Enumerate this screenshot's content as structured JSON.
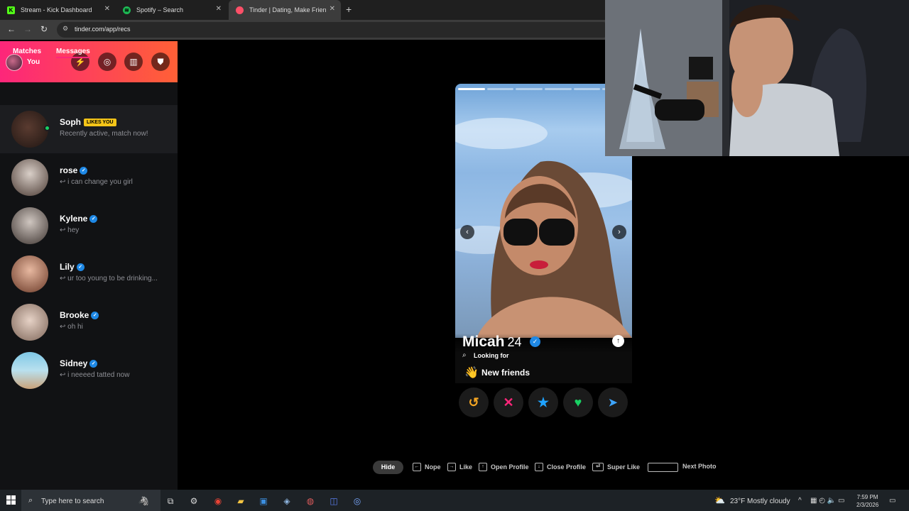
{
  "browser": {
    "tabs": [
      {
        "title": "Stream - Kick Dashboard",
        "icon": "kick-icon",
        "color": "#53fc18"
      },
      {
        "title": "Spotify – Search",
        "icon": "spotify-icon",
        "color": "#1db954"
      },
      {
        "title": "Tinder | Dating, Make Friends &",
        "icon": "tinder-icon",
        "color": "#fd5068"
      }
    ],
    "url": "tinder.com/app/recs"
  },
  "sidebar": {
    "you_label": "You",
    "tabs": {
      "matches": "Matches",
      "messages": "Messages"
    },
    "messages": [
      {
        "name": "Soph",
        "badge": "LIKES YOU",
        "preview": "Recently active, match now!"
      },
      {
        "name": "rose",
        "preview": "↩ i can change you girl"
      },
      {
        "name": "Kylene",
        "preview": "↩ hey"
      },
      {
        "name": "Lily",
        "preview": "↩ ur too young to be drinking..."
      },
      {
        "name": "Brooke",
        "preview": "↩ oh hi"
      },
      {
        "name": "Sidney",
        "preview": "↩ i neeeed tatted now"
      }
    ]
  },
  "card": {
    "name": "Micah",
    "age": "24",
    "looking_for_label": "Looking for",
    "looking_for_value": "New friends",
    "photo_count": 6,
    "current_photo": 1
  },
  "shortcuts": {
    "hide": "Hide",
    "nope": "Nope",
    "like": "Like",
    "open_profile": "Open Profile",
    "close_profile": "Close Profile",
    "super_like": "Super Like",
    "next_photo": "Next Photo"
  },
  "taskbar": {
    "search_placeholder": "Type here to search",
    "weather": "23°F  Mostly cloudy",
    "time": "7:59 PM",
    "date": "2/3/2026"
  },
  "colors": {
    "brand_gradient_start": "#fd267a",
    "brand_gradient_end": "#ff6036",
    "rewind": "#f5a623",
    "nope": "#fd267a",
    "super_like": "#1fa3ff",
    "like": "#19d163",
    "boost": "#3ea5ff"
  }
}
